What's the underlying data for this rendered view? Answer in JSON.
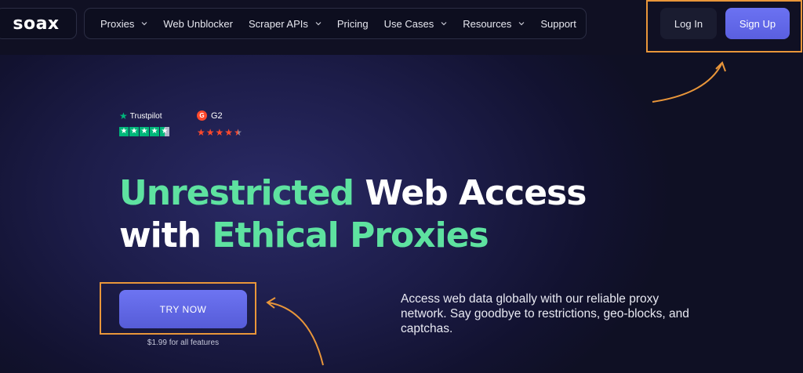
{
  "brand": {
    "logo_text": "soax"
  },
  "nav": {
    "items": [
      {
        "label": "Proxies",
        "has_dropdown": true
      },
      {
        "label": "Web Unblocker",
        "has_dropdown": false
      },
      {
        "label": "Scraper APIs",
        "has_dropdown": true
      },
      {
        "label": "Pricing",
        "has_dropdown": false
      },
      {
        "label": "Use Cases",
        "has_dropdown": true
      },
      {
        "label": "Resources",
        "has_dropdown": true
      },
      {
        "label": "Support",
        "has_dropdown": false
      }
    ]
  },
  "auth": {
    "login_label": "Log In",
    "signup_label": "Sign Up"
  },
  "ratings": {
    "trustpilot": {
      "label": "Trustpilot",
      "stars": 4.5
    },
    "g2": {
      "label": "G2",
      "stars": 4.5
    }
  },
  "hero": {
    "headline_part1": "Unrestricted",
    "headline_part2": " Web Access",
    "headline_part3": "with ",
    "headline_part4": "Ethical Proxies",
    "cta_label": "TRY NOW",
    "price_note": "$1.99 for all features",
    "description": "Access web data globally with our reliable proxy network. Say goodbye to restrictions, geo-blocks, and captchas."
  },
  "colors": {
    "accent_green": "#5ee2a0",
    "accent_purple": "#6b72f2",
    "highlight_orange": "#e9963a",
    "trustpilot_green": "#00b67a",
    "g2_red": "#ff492c",
    "background": "#0f1024"
  },
  "icons": {
    "nav_dropdown": "chevron-down-icon",
    "trustpilot": "trustpilot-star-icon",
    "g2": "g2-logo-icon"
  }
}
